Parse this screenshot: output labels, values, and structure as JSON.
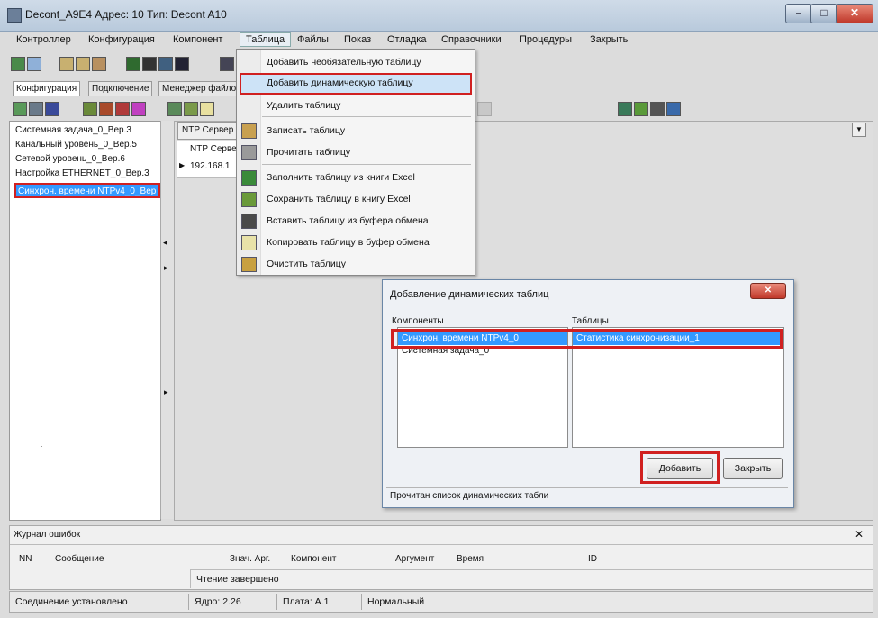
{
  "window": {
    "title": "Decont_A9E4   Адрес: 10   Тип: Decont A10"
  },
  "menubar": {
    "items": [
      "Контроллер",
      "Конфигурация",
      "Компонент",
      "Таблица",
      "Файлы",
      "Показ",
      "Отладка",
      "Справочники",
      "Процедуры",
      "Закрыть"
    ]
  },
  "tabs": {
    "config": "Конфигурация",
    "connection": "Подключение",
    "filemanager": "Менеджер файлов"
  },
  "tree": {
    "items": [
      "Системная задача_0_Вер.3",
      "Канальный уровень_0_Вер.5",
      "Сетевой уровень_0_Вер.6",
      "Настройка ETHERNET_0_Вер.3",
      "Синхрон. времени NTPv4_0_Вер"
    ]
  },
  "ntp": {
    "tab_label": "NTP Сервер",
    "column_header": "NTP Серве",
    "row_value": "192.168.1"
  },
  "dropdown": {
    "items": [
      "Добавить необязательную таблицу",
      "Добавить динамическую таблицу",
      "Удалить таблицу",
      "Записать таблицу",
      "Прочитать таблицу",
      "Заполнить таблицу из книги Excel",
      "Сохранить таблицу в книгу Excel",
      "Вставить таблицу из буфера обмена",
      "Копировать таблицу в буфер обмена",
      "Очистить таблицу"
    ]
  },
  "dialog": {
    "title": "Добавление динамических таблиц",
    "components_label": "Компоненты",
    "tables_label": "Таблицы",
    "components": [
      "Синхрон. времени NTPv4_0",
      "Системная задача_0"
    ],
    "tables": [
      "Статистика синхронизации_1"
    ],
    "add_button": "Добавить",
    "close_button": "Закрыть",
    "status": "Прочитан список динамических табли"
  },
  "errlog": {
    "title": "Журнал ошибок",
    "columns": [
      "NN",
      "Сообщение",
      "Знач. Арг.",
      "Компонент",
      "Аргумент",
      "Время",
      "ID"
    ],
    "status_message": "Чтение завершено"
  },
  "statusbar": {
    "connection": "Соединение установлено",
    "core": "Ядро: 2.26",
    "board": "Плата: A.1",
    "mode": "Нормальный"
  },
  "colors": {
    "highlight_border": "#d02020",
    "selection": "#3399ff"
  }
}
